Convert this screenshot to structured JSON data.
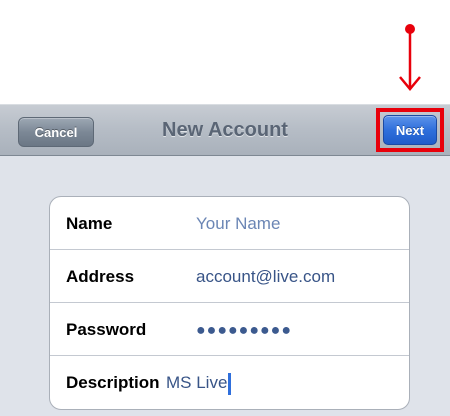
{
  "navbar": {
    "title": "New Account",
    "cancel_label": "Cancel",
    "next_label": "Next"
  },
  "form": {
    "rows": [
      {
        "label": "Name",
        "value": "Your Name",
        "is_placeholder": true
      },
      {
        "label": "Address",
        "value": "account@live.com",
        "is_placeholder": false
      },
      {
        "label": "Password",
        "value": "●●●●●●●●●",
        "is_placeholder": false
      },
      {
        "label": "Description",
        "value": "MS Live",
        "is_placeholder": false
      }
    ]
  },
  "annotation": {
    "target": "next-button",
    "color": "#e8000b"
  },
  "colors": {
    "accent_blue": "#2f6fdc",
    "navbar_gray": "#b6bdc6",
    "background": "#dfe3ea",
    "value_text": "#385487",
    "highlight_red": "#e8000b"
  }
}
